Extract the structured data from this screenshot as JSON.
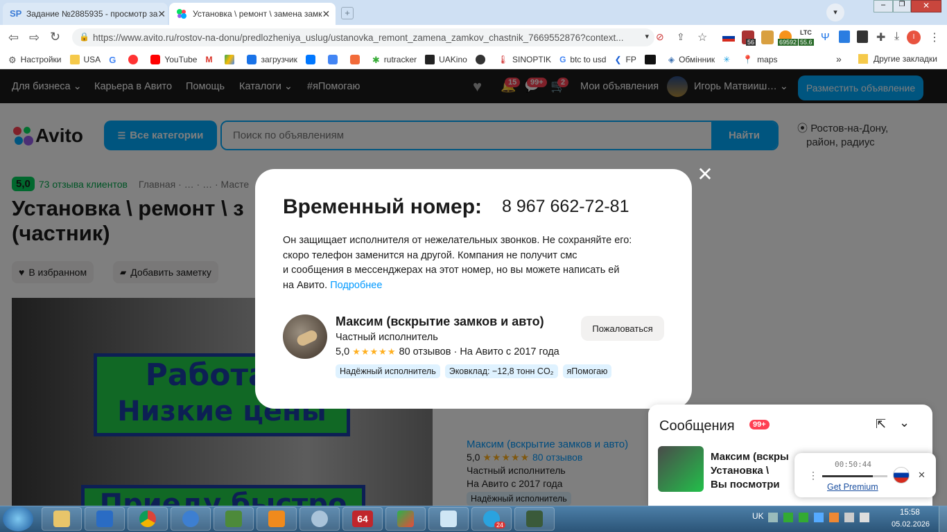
{
  "browser": {
    "tabs": [
      {
        "title": "Задание №2885935 - просмотр за",
        "favicon": "SP"
      },
      {
        "title": "Установка \\ ремонт \\ замена замк",
        "favicon": "avito"
      }
    ],
    "url": "https://www.avito.ru/rostov-na-donu/predlozheniya_uslug/ustanovka_remont_zamena_zamkov_chastnik_7669552876?context...",
    "ext_badges": {
      "b1": "56",
      "btc": "69592",
      "ltc_label": "LTC",
      "ltc": "55.6",
      "profile_initial": "I"
    },
    "bookmarks": [
      "Настройки",
      "USA",
      "",
      "",
      "YouTube",
      "",
      "",
      "загрузчик",
      "",
      "",
      "",
      "rutracker",
      "UAKino",
      "",
      "SINOPTIK",
      "btc to usd",
      "FP",
      "",
      "Обмінник",
      "",
      "maps"
    ],
    "bookmarks_more": "»",
    "other_bookmarks": "Другие закладки"
  },
  "avito": {
    "nav": {
      "business": "Для бизнеса",
      "career": "Карьера в Авито",
      "help": "Помощь",
      "catalogs": "Каталоги",
      "ihelp": "#яПомогаю",
      "notif_badge": "15",
      "msg_badge": "99+",
      "cart_badge": "2",
      "my_ads": "Мои объявления",
      "user": "Игорь Матвииш…",
      "post_button": "Разместить объявление"
    },
    "logo_text": "Avito",
    "all_categories": "Все категории",
    "search_placeholder": "Поиск по объявлениям",
    "search_button": "Найти",
    "location": [
      "Ростов-на-Дону,",
      "район, радиус"
    ],
    "rating_score": "5,0",
    "rating_reviews": "73 отзыва клиентов",
    "breadcrumbs": "Главная · … · … · Масте",
    "title_line1": "Установка \\ ремонт \\ з",
    "title_line2": "(частник)",
    "favorite_button": "В избранном",
    "note_button": "Добавить заметку",
    "photo_text": {
      "line1": "Работаю",
      "line2": "Низкие цены",
      "line3": "Приеду быстро"
    },
    "seller_side": {
      "name": "Максим (вскрытие замков и авто)",
      "rating": "5,0",
      "stars": "★★★★★",
      "reviews": "80 отзывов",
      "type": "Частный исполнитель",
      "since": "На Авито с 2017 года",
      "tag": "Надёжный исполнитель"
    }
  },
  "modal": {
    "title": "Временный номер:",
    "phone": "8 967 662-72-81",
    "desc_lines": [
      "Он защищает исполнителя от нежелательных звонков. Не сохраняйте его:",
      "скоро телефон заменится на другой. Компания не получит смс",
      "и сообщения в мессенджерах на этот номер, но вы можете написать ей",
      "на Авито."
    ],
    "more_link": "Подробнее",
    "seller_name": "Максим (вскрытие замков и авто)",
    "seller_type": "Частный исполнитель",
    "rating": "5,0",
    "stars": "★★★★★",
    "reviews": "80 отзывов",
    "since": "· На Авито с 2017 года",
    "tags": [
      "Надёжный исполнитель",
      "Эковклад: −12,8 тонн CO₂",
      "яПомогаю"
    ],
    "complain_button": "Пожаловаться",
    "close": "✕"
  },
  "messages": {
    "title": "Сообщения",
    "badge": "99+",
    "line1": "Максим (вскры",
    "line2": "Установка \\",
    "line3": "Вы посмотри"
  },
  "player": {
    "time": "00:50:44",
    "progress": 0.78,
    "premium": "Get Premium",
    "close": "✕"
  },
  "taskbar": {
    "lang": "UK",
    "time": "15:58",
    "date": "05.02.2026",
    "telegram_badge": "24"
  },
  "colors": {
    "accent": "#00aaff",
    "badge": "#ff4053",
    "green": "#02d15c",
    "star": "#ffb021"
  }
}
